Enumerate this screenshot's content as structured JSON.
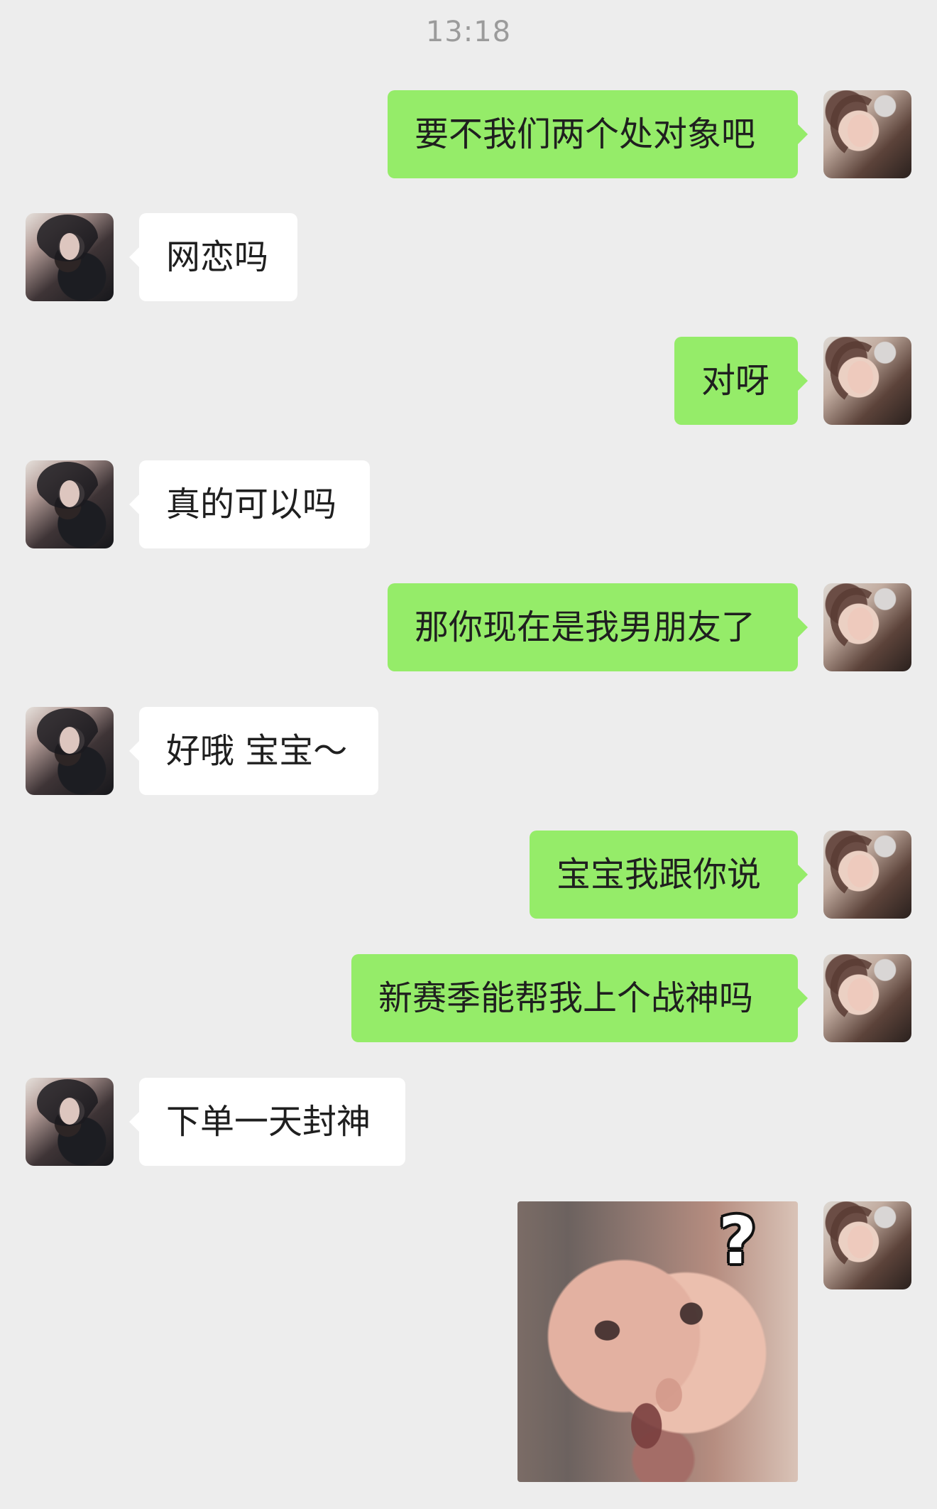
{
  "status": {
    "time": "13:18"
  },
  "messages": [
    {
      "side": "right",
      "text": "要不我们两个处对象吧"
    },
    {
      "side": "left",
      "text": "网恋吗"
    },
    {
      "side": "right",
      "text": "对呀"
    },
    {
      "side": "left",
      "text": "真的可以吗"
    },
    {
      "side": "right",
      "text": "那你现在是我男朋友了"
    },
    {
      "side": "left",
      "text": "好哦 宝宝～"
    },
    {
      "side": "right",
      "text": "宝宝我跟你说"
    },
    {
      "side": "right",
      "text": "新赛季能帮我上个战神吗"
    },
    {
      "side": "left",
      "text": "下单一天封神"
    }
  ],
  "sticker": {
    "symbol": "?"
  }
}
